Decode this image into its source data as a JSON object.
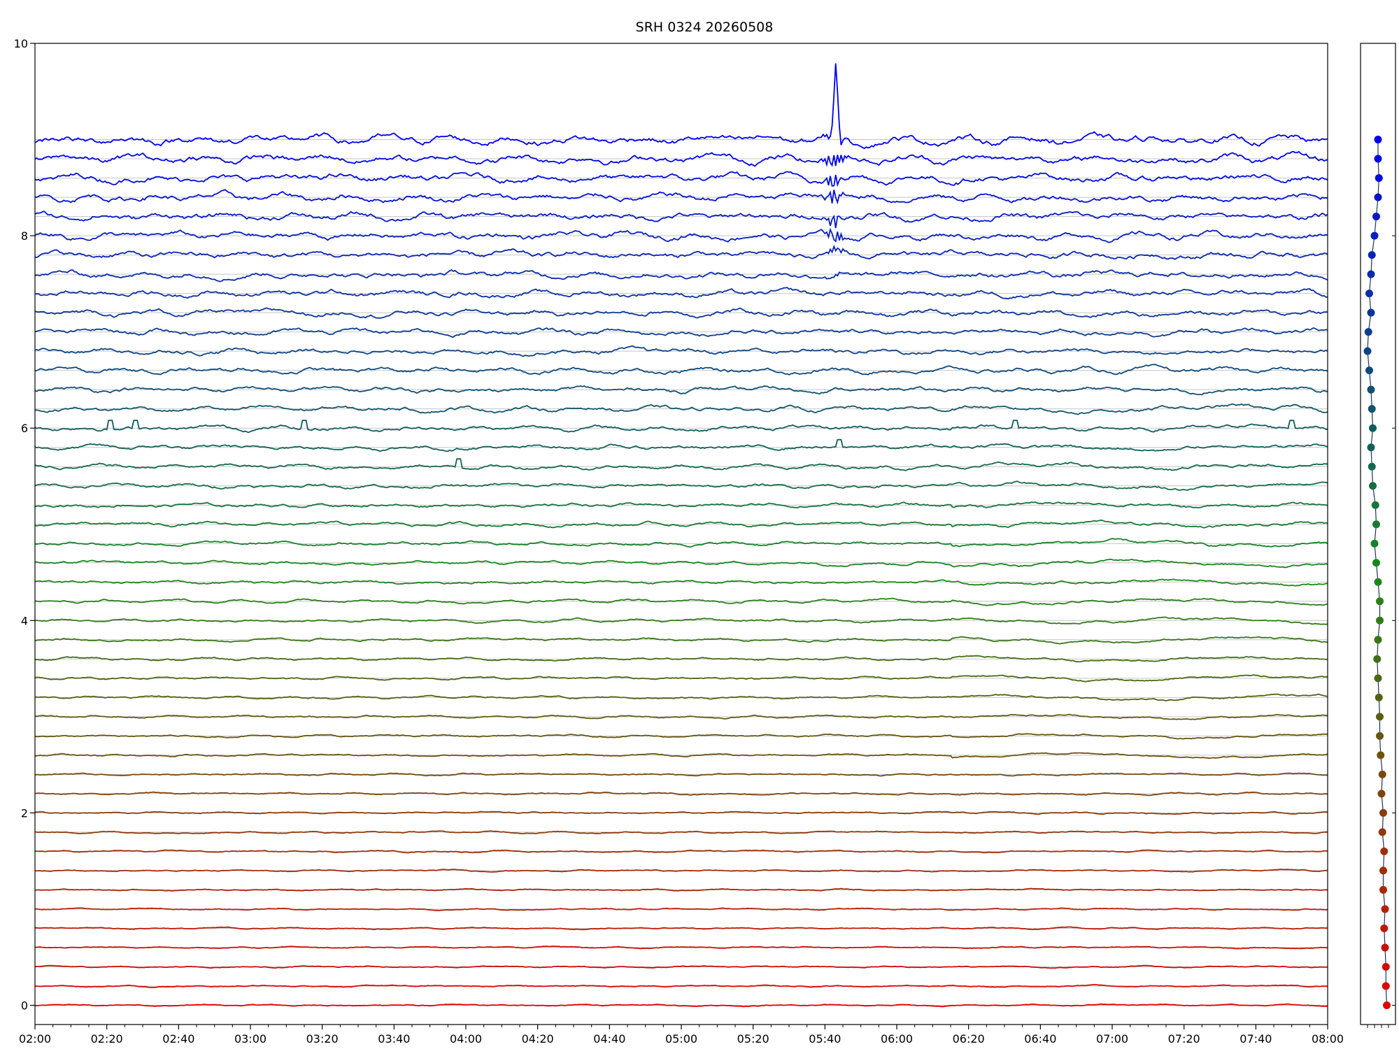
{
  "chart_data": [
    {
      "type": "line",
      "title": "SRH 0324 20260508",
      "xlabel": "",
      "ylabel": "",
      "x_range": [
        "02:00",
        "08:00"
      ],
      "x_ticks": [
        "02:00",
        "02:20",
        "02:40",
        "03:00",
        "03:20",
        "03:40",
        "04:00",
        "04:20",
        "04:40",
        "05:00",
        "05:20",
        "05:40",
        "06:00",
        "06:20",
        "06:40",
        "07:00",
        "07:20",
        "07:40",
        "08:00"
      ],
      "ylim": [
        -0.2,
        10
      ],
      "y_ticks": [
        0,
        2,
        4,
        6,
        8,
        10
      ],
      "grid": "horizontal reference line at each trace baseline",
      "legend": "none",
      "series_count": 46,
      "baseline_start": 0,
      "baseline_step": 0.2,
      "color_start": "#e00000",
      "color_mid": "#1a8a1a",
      "color_end": "#0000ee",
      "events": [
        {
          "time": "05:43",
          "note": "large spike on top traces",
          "peak": 9.95
        },
        {
          "time": "05:40",
          "note": "burst visible on upper traces"
        }
      ],
      "step_spikes": [
        {
          "trace": 30,
          "times": [
            "02:21",
            "02:28",
            "03:15",
            "06:33",
            "07:50"
          ]
        },
        {
          "trace": 29,
          "times": [
            "05:44"
          ]
        },
        {
          "trace": 28,
          "times": [
            "03:58"
          ]
        }
      ],
      "trace_color": "#e00000"
    },
    {
      "type": "scatter",
      "title": "",
      "points_count": 46,
      "baseline_start": 0,
      "baseline_step": 0.2,
      "offsets": [
        0.5,
        0.45,
        0.45,
        0.4,
        0.35,
        0.4,
        0.3,
        0.3,
        0.35,
        0.25,
        0.3,
        0.2,
        0.25,
        0.15,
        0.1,
        0.1,
        0.05,
        0.0,
        -0.05,
        0.0,
        0.1,
        0.1,
        0.0,
        -0.1,
        -0.2,
        -0.1,
        -0.15,
        -0.3,
        -0.35,
        -0.4,
        -0.3,
        -0.35,
        -0.4,
        -0.5,
        -0.6,
        -0.55,
        -0.4,
        -0.5,
        -0.4,
        -0.35,
        -0.2,
        -0.1,
        0.0,
        0.05,
        0.0,
        0.0
      ],
      "xlim": [
        -1,
        1
      ]
    }
  ]
}
